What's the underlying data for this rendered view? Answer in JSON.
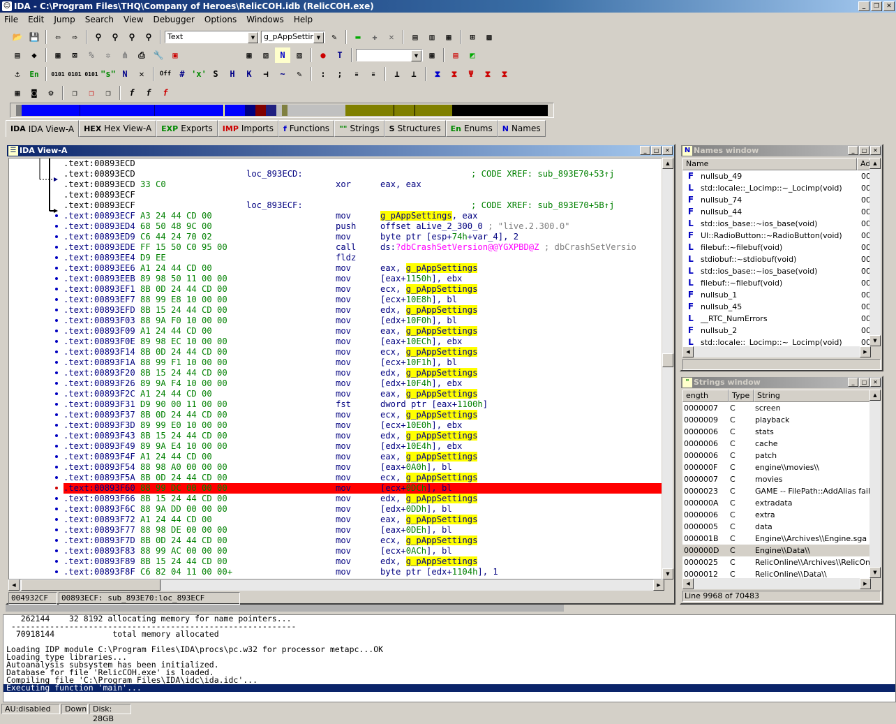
{
  "window": {
    "title": "IDA - C:\\Program Files\\THQ\\Company of Heroes\\RelicCOH.idb (RelicCOH.exe)"
  },
  "menu": [
    "File",
    "Edit",
    "Jump",
    "Search",
    "View",
    "Debugger",
    "Options",
    "Windows",
    "Help"
  ],
  "toolbar": {
    "segment_combo": "Text",
    "name_combo": "g_pAppSetting",
    "empty_combo": ""
  },
  "tabs": [
    {
      "icon": "IDA",
      "label": "IDA View-A"
    },
    {
      "icon": "HEX",
      "label": "Hex View-A"
    },
    {
      "icon": "EXP",
      "label": "Exports"
    },
    {
      "icon": "IMP",
      "label": "Imports"
    },
    {
      "icon": "f",
      "label": "Functions"
    },
    {
      "icon": "\"\"",
      "label": "Strings"
    },
    {
      "icon": "S",
      "label": "Structures"
    },
    {
      "icon": "En",
      "label": "Enums"
    },
    {
      "icon": "N",
      "label": "Names"
    }
  ],
  "ida_view": {
    "title": "IDA View-A",
    "lines": [
      {
        "addr": ".text:00893ECD",
        "bytes": "",
        "label": "",
        "mn": "",
        "op": "",
        "cmt": ""
      },
      {
        "addr": ".text:00893ECD",
        "bytes": "",
        "label": "loc_893ECD:",
        "mn": "",
        "op": "",
        "cmt": "; CODE XREF: sub_893E70+53↑j"
      },
      {
        "addr": ".text:00893ECD",
        "bytes": "33 C0",
        "label": "",
        "mn": "xor",
        "op": "eax, eax",
        "cmt": ""
      },
      {
        "addr": ".text:00893ECF",
        "bytes": "",
        "label": "",
        "mn": "",
        "op": "",
        "cmt": ""
      },
      {
        "addr": ".text:00893ECF",
        "bytes": "",
        "label": "loc_893ECF:",
        "mn": "",
        "op": "",
        "cmt": "; CODE XREF: sub_893E70+5B↑j"
      },
      {
        "addr": ".text:00893ECF",
        "bytes": "A3 24 44 CD 00",
        "label": "",
        "mn": "mov",
        "op": "g_pAppSettings, eax",
        "cmt": ""
      },
      {
        "addr": ".text:00893ED4",
        "bytes": "68 50 48 9C 00",
        "label": "",
        "mn": "push",
        "op": "offset aLive_2_300_0 ; \"live.2.300.0\"",
        "cmt": ""
      },
      {
        "addr": ".text:00893ED9",
        "bytes": "C6 44 24 70 02",
        "label": "",
        "mn": "mov",
        "op": "byte ptr [esp+74h+var_4], 2",
        "cmt": ""
      },
      {
        "addr": ".text:00893EDE",
        "bytes": "FF 15 50 C0 95 00",
        "label": "",
        "mn": "call",
        "op": "ds:?dbCrashSetVersion@@YGXPBD@Z ; dbCrashSetVersio",
        "cmt": ""
      },
      {
        "addr": ".text:00893EE4",
        "bytes": "D9 EE",
        "label": "",
        "mn": "fldz",
        "op": "",
        "cmt": ""
      },
      {
        "addr": ".text:00893EE6",
        "bytes": "A1 24 44 CD 00",
        "label": "",
        "mn": "mov",
        "op": "eax, g_pAppSettings",
        "cmt": ""
      },
      {
        "addr": ".text:00893EEB",
        "bytes": "89 98 50 11 00 00",
        "label": "",
        "mn": "mov",
        "op": "[eax+1150h], ebx",
        "cmt": ""
      },
      {
        "addr": ".text:00893EF1",
        "bytes": "8B 0D 24 44 CD 00",
        "label": "",
        "mn": "mov",
        "op": "ecx, g_pAppSettings",
        "cmt": ""
      },
      {
        "addr": ".text:00893EF7",
        "bytes": "88 99 E8 10 00 00",
        "label": "",
        "mn": "mov",
        "op": "[ecx+10E8h], bl",
        "cmt": ""
      },
      {
        "addr": ".text:00893EFD",
        "bytes": "8B 15 24 44 CD 00",
        "label": "",
        "mn": "mov",
        "op": "edx, g_pAppSettings",
        "cmt": ""
      },
      {
        "addr": ".text:00893F03",
        "bytes": "88 9A F0 10 00 00",
        "label": "",
        "mn": "mov",
        "op": "[edx+10F0h], bl",
        "cmt": ""
      },
      {
        "addr": ".text:00893F09",
        "bytes": "A1 24 44 CD 00",
        "label": "",
        "mn": "mov",
        "op": "eax, g_pAppSettings",
        "cmt": ""
      },
      {
        "addr": ".text:00893F0E",
        "bytes": "89 98 EC 10 00 00",
        "label": "",
        "mn": "mov",
        "op": "[eax+10ECh], ebx",
        "cmt": ""
      },
      {
        "addr": ".text:00893F14",
        "bytes": "8B 0D 24 44 CD 00",
        "label": "",
        "mn": "mov",
        "op": "ecx, g_pAppSettings",
        "cmt": ""
      },
      {
        "addr": ".text:00893F1A",
        "bytes": "88 99 F1 10 00 00",
        "label": "",
        "mn": "mov",
        "op": "[ecx+10F1h], bl",
        "cmt": ""
      },
      {
        "addr": ".text:00893F20",
        "bytes": "8B 15 24 44 CD 00",
        "label": "",
        "mn": "mov",
        "op": "edx, g_pAppSettings",
        "cmt": ""
      },
      {
        "addr": ".text:00893F26",
        "bytes": "89 9A F4 10 00 00",
        "label": "",
        "mn": "mov",
        "op": "[edx+10F4h], ebx",
        "cmt": ""
      },
      {
        "addr": ".text:00893F2C",
        "bytes": "A1 24 44 CD 00",
        "label": "",
        "mn": "mov",
        "op": "eax, g_pAppSettings",
        "cmt": ""
      },
      {
        "addr": ".text:00893F31",
        "bytes": "D9 90 00 11 00 00",
        "label": "",
        "mn": "fst",
        "op": "dword ptr [eax+1100h]",
        "cmt": ""
      },
      {
        "addr": ".text:00893F37",
        "bytes": "8B 0D 24 44 CD 00",
        "label": "",
        "mn": "mov",
        "op": "ecx, g_pAppSettings",
        "cmt": ""
      },
      {
        "addr": ".text:00893F3D",
        "bytes": "89 99 E0 10 00 00",
        "label": "",
        "mn": "mov",
        "op": "[ecx+10E0h], ebx",
        "cmt": ""
      },
      {
        "addr": ".text:00893F43",
        "bytes": "8B 15 24 44 CD 00",
        "label": "",
        "mn": "mov",
        "op": "edx, g_pAppSettings",
        "cmt": ""
      },
      {
        "addr": ".text:00893F49",
        "bytes": "89 9A E4 10 00 00",
        "label": "",
        "mn": "mov",
        "op": "[edx+10E4h], ebx",
        "cmt": ""
      },
      {
        "addr": ".text:00893F4F",
        "bytes": "A1 24 44 CD 00",
        "label": "",
        "mn": "mov",
        "op": "eax, g_pAppSettings",
        "cmt": ""
      },
      {
        "addr": ".text:00893F54",
        "bytes": "88 98 A0 00 00 00",
        "label": "",
        "mn": "mov",
        "op": "[eax+0A0h], bl",
        "cmt": ""
      },
      {
        "addr": ".text:00893F5A",
        "bytes": "8B 0D 24 44 CD 00",
        "label": "",
        "mn": "mov",
        "op": "ecx, g_pAppSettings",
        "cmt": ""
      },
      {
        "addr": ".text:00893F60",
        "bytes": "88 99 DC 00 00 00",
        "label": "",
        "mn": "mov",
        "op": "[ecx+0DCh], bl",
        "cmt": "",
        "bp": true
      },
      {
        "addr": ".text:00893F66",
        "bytes": "8B 15 24 44 CD 00",
        "label": "",
        "mn": "mov",
        "op": "edx, g_pAppSettings",
        "cmt": ""
      },
      {
        "addr": ".text:00893F6C",
        "bytes": "88 9A DD 00 00 00",
        "label": "",
        "mn": "mov",
        "op": "[edx+0DDh], bl",
        "cmt": ""
      },
      {
        "addr": ".text:00893F72",
        "bytes": "A1 24 44 CD 00",
        "label": "",
        "mn": "mov",
        "op": "eax, g_pAppSettings",
        "cmt": ""
      },
      {
        "addr": ".text:00893F77",
        "bytes": "88 98 DE 00 00 00",
        "label": "",
        "mn": "mov",
        "op": "[eax+0DEh], bl",
        "cmt": ""
      },
      {
        "addr": ".text:00893F7D",
        "bytes": "8B 0D 24 44 CD 00",
        "label": "",
        "mn": "mov",
        "op": "ecx, g_pAppSettings",
        "cmt": ""
      },
      {
        "addr": ".text:00893F83",
        "bytes": "88 99 AC 00 00 00",
        "label": "",
        "mn": "mov",
        "op": "[ecx+0ACh], bl",
        "cmt": ""
      },
      {
        "addr": ".text:00893F89",
        "bytes": "8B 15 24 44 CD 00",
        "label": "",
        "mn": "mov",
        "op": "edx, g_pAppSettings",
        "cmt": ""
      },
      {
        "addr": ".text:00893F8F",
        "bytes": "C6 82 04 11 00 00+",
        "label": "",
        "mn": "mov",
        "op": "byte ptr [edx+1104h], 1",
        "cmt": ""
      }
    ],
    "status_offset": "004932CF",
    "status_location": "00893ECF: sub_893E70:loc_893ECF"
  },
  "names_window": {
    "title": "Names window",
    "columns": [
      "Name",
      "Ad"
    ],
    "rows": [
      {
        "kind": "F",
        "name": "nullsub_49",
        "ad": "00"
      },
      {
        "kind": "L",
        "name": "std::locale::_Locimp::~_Locimp(void)",
        "ad": "00"
      },
      {
        "kind": "F",
        "name": "nullsub_74",
        "ad": "00"
      },
      {
        "kind": "F",
        "name": "nullsub_44",
        "ad": "00"
      },
      {
        "kind": "L",
        "name": "std::ios_base::~ios_base(void)",
        "ad": "00"
      },
      {
        "kind": "F",
        "name": "UI::RadioButton::~RadioButton(void)",
        "ad": "00"
      },
      {
        "kind": "L",
        "name": "filebuf::~filebuf(void)",
        "ad": "00"
      },
      {
        "kind": "L",
        "name": "stdiobuf::~stdiobuf(void)",
        "ad": "00"
      },
      {
        "kind": "L",
        "name": "std::ios_base::~ios_base(void)",
        "ad": "00"
      },
      {
        "kind": "L",
        "name": "filebuf::~filebuf(void)",
        "ad": "00"
      },
      {
        "kind": "F",
        "name": "nullsub_1",
        "ad": "00"
      },
      {
        "kind": "F",
        "name": "nullsub_45",
        "ad": "00"
      },
      {
        "kind": "L",
        "name": "__RTC_NumErrors",
        "ad": "00"
      },
      {
        "kind": "F",
        "name": "nullsub_2",
        "ad": "00"
      },
      {
        "kind": "L",
        "name": "std::locale::_Locimp::~_Locimp(void)",
        "ad": "00"
      }
    ]
  },
  "strings_window": {
    "title": "Strings window",
    "columns": [
      "ength",
      "Type",
      "String"
    ],
    "rows": [
      {
        "len": "0000007",
        "type": "C",
        "str": "screen"
      },
      {
        "len": "0000009",
        "type": "C",
        "str": "playback"
      },
      {
        "len": "0000006",
        "type": "C",
        "str": "stats"
      },
      {
        "len": "0000006",
        "type": "C",
        "str": "cache"
      },
      {
        "len": "0000006",
        "type": "C",
        "str": "patch"
      },
      {
        "len": "000000F",
        "type": "C",
        "str": "engine\\\\movies\\\\"
      },
      {
        "len": "0000007",
        "type": "C",
        "str": "movies"
      },
      {
        "len": "0000023",
        "type": "C",
        "str": "GAME -- FilePath::AddAlias failure"
      },
      {
        "len": "000000A",
        "type": "C",
        "str": "extradata"
      },
      {
        "len": "0000006",
        "type": "C",
        "str": "extra"
      },
      {
        "len": "0000005",
        "type": "C",
        "str": "data"
      },
      {
        "len": "000001B",
        "type": "C",
        "str": "Engine\\\\Archives\\\\Engine.sga"
      },
      {
        "len": "000000D",
        "type": "C",
        "str": "Engine\\\\Data\\\\",
        "sel": true
      },
      {
        "len": "0000025",
        "type": "C",
        "str": "RelicOnline\\\\Archives\\\\RelicOnline"
      },
      {
        "len": "0000012",
        "type": "C",
        "str": "RelicOnline\\\\Data\\\\"
      }
    ],
    "status": "Line 9968 of 70483"
  },
  "output": [
    "   262144    32 8192 allocating memory for name pointers...",
    " -----------------------------------------------------------",
    "  70918144            total memory allocated",
    "",
    "Loading IDP module C:\\Program Files\\IDA\\procs\\pc.w32 for processor metapc...OK",
    "Loading type libraries...",
    "Autoanalysis subsystem has been initialized.",
    "Database for file 'RelicCOH.exe' is loaded.",
    "Compiling file 'C:\\Program Files\\IDA\\idc\\ida.idc'...",
    "Executing function 'main'..."
  ],
  "statusbar": {
    "au": "AU:disabled",
    "dir": "Down",
    "disk": "Disk: 28GB"
  }
}
